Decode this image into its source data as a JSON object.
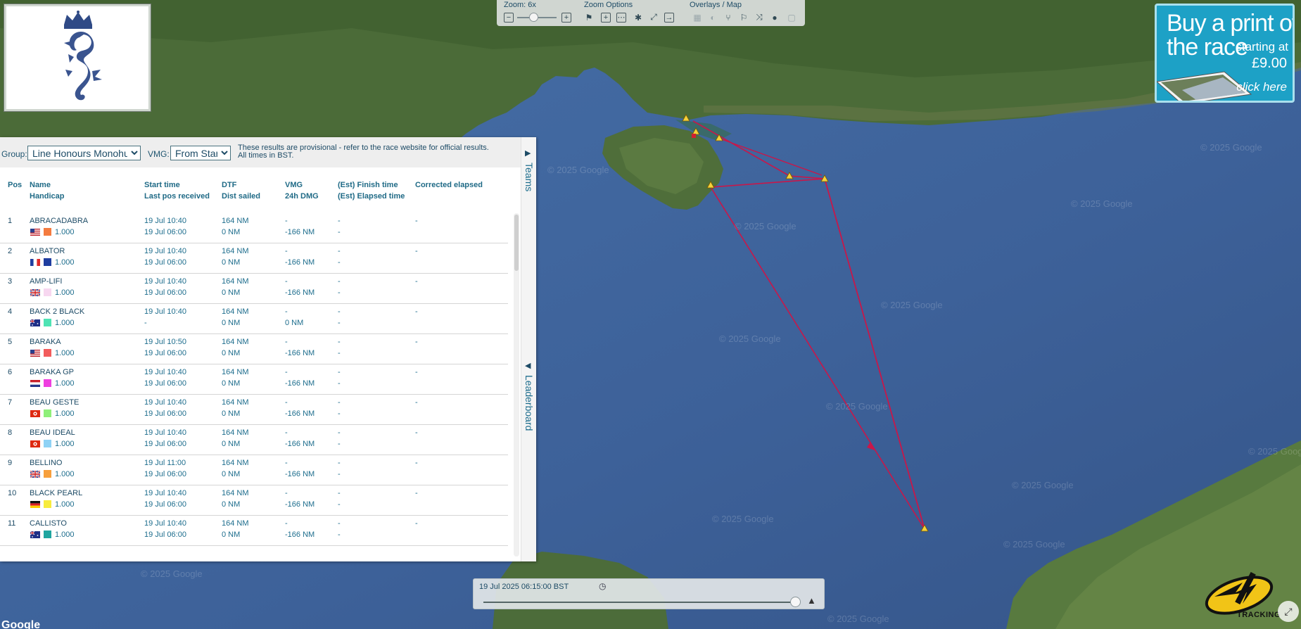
{
  "map": {
    "watermark": "© 2025 Google",
    "google_logo": "Google"
  },
  "toolbar": {
    "zoom_label": "Zoom: 6x",
    "zoom_options_label": "Zoom Options",
    "overlays_label": "Overlays / Map"
  },
  "print_ad": {
    "line1": "Buy a print of",
    "line2": "the race",
    "starting": "starting at",
    "price": "£9.00",
    "click": "click here"
  },
  "leaderboard": {
    "group_label": "Group:",
    "group_value": "Line Honours Monohull",
    "vmg_label": "VMG:",
    "vmg_value": "From Start",
    "note_line1": "These results are provisional - refer to the race website for official results.",
    "note_line2": "All times in BST.",
    "tab_teams": "Teams",
    "tab_leaderboard": "Leaderboard",
    "columns": {
      "pos": "Pos",
      "name": "Name",
      "handicap": "Handicap",
      "start": "Start time",
      "last_pos": "Last pos received",
      "dtf": "DTF",
      "dist": "Dist sailed",
      "vmg": "VMG",
      "dmg": "24h DMG",
      "finish": "(Est) Finish time",
      "elapsed": "(Est) Elapsed time",
      "corrected": "Corrected elapsed"
    },
    "rows": [
      {
        "pos": "1",
        "name": "ABRACADABRA",
        "flag": "us",
        "color": "#f47b3f",
        "handicap": "1.000",
        "start": "19 Jul 10:40",
        "last": "19 Jul 06:00",
        "dtf": "164 NM",
        "dist": "0 NM",
        "vmg": "-",
        "dmg": "-166 NM",
        "finish": "-",
        "elapsed": "-",
        "corrected": "-"
      },
      {
        "pos": "2",
        "name": "ALBATOR",
        "flag": "fr",
        "color": "#1f3ea0",
        "handicap": "1.000",
        "start": "19 Jul 10:40",
        "last": "19 Jul 06:00",
        "dtf": "164 NM",
        "dist": "0 NM",
        "vmg": "-",
        "dmg": "-166 NM",
        "finish": "-",
        "elapsed": "-",
        "corrected": "-"
      },
      {
        "pos": "3",
        "name": "AMP-LIFI",
        "flag": "gb",
        "color": "#f7d7f0",
        "handicap": "1.000",
        "start": "19 Jul 10:40",
        "last": "19 Jul 06:00",
        "dtf": "164 NM",
        "dist": "0 NM",
        "vmg": "-",
        "dmg": "-166 NM",
        "finish": "-",
        "elapsed": "-",
        "corrected": "-"
      },
      {
        "pos": "4",
        "name": "BACK 2 BLACK",
        "flag": "au",
        "color": "#4fe3b4",
        "handicap": "1.000",
        "start": "19 Jul 10:40",
        "last": "-",
        "dtf": "164 NM",
        "dist": "0 NM",
        "vmg": "-",
        "dmg": "0 NM",
        "finish": "-",
        "elapsed": "-",
        "corrected": "-"
      },
      {
        "pos": "5",
        "name": "BARAKA",
        "flag": "us",
        "color": "#f25c5c",
        "handicap": "1.000",
        "start": "19 Jul 10:50",
        "last": "19 Jul 06:00",
        "dtf": "164 NM",
        "dist": "0 NM",
        "vmg": "-",
        "dmg": "-166 NM",
        "finish": "-",
        "elapsed": "-",
        "corrected": "-"
      },
      {
        "pos": "6",
        "name": "BARAKA GP",
        "flag": "nl",
        "color": "#ef3fe0",
        "handicap": "1.000",
        "start": "19 Jul 10:40",
        "last": "19 Jul 06:00",
        "dtf": "164 NM",
        "dist": "0 NM",
        "vmg": "-",
        "dmg": "-166 NM",
        "finish": "-",
        "elapsed": "-",
        "corrected": "-"
      },
      {
        "pos": "7",
        "name": "BEAU GESTE",
        "flag": "hk",
        "color": "#8ff07a",
        "handicap": "1.000",
        "start": "19 Jul 10:40",
        "last": "19 Jul 06:00",
        "dtf": "164 NM",
        "dist": "0 NM",
        "vmg": "-",
        "dmg": "-166 NM",
        "finish": "-",
        "elapsed": "-",
        "corrected": "-"
      },
      {
        "pos": "8",
        "name": "BEAU IDEAL",
        "flag": "hk",
        "color": "#8fd2f5",
        "handicap": "1.000",
        "start": "19 Jul 10:40",
        "last": "19 Jul 06:00",
        "dtf": "164 NM",
        "dist": "0 NM",
        "vmg": "-",
        "dmg": "-166 NM",
        "finish": "-",
        "elapsed": "-",
        "corrected": "-"
      },
      {
        "pos": "9",
        "name": "BELLINO",
        "flag": "gb",
        "color": "#f7a03d",
        "handicap": "1.000",
        "start": "19 Jul 11:00",
        "last": "19 Jul 06:00",
        "dtf": "164 NM",
        "dist": "0 NM",
        "vmg": "-",
        "dmg": "-166 NM",
        "finish": "-",
        "elapsed": "-",
        "corrected": "-"
      },
      {
        "pos": "10",
        "name": "BLACK PEARL",
        "flag": "de",
        "color": "#f7ec3d",
        "handicap": "1.000",
        "start": "19 Jul 10:40",
        "last": "19 Jul 06:00",
        "dtf": "164 NM",
        "dist": "0 NM",
        "vmg": "-",
        "dmg": "-166 NM",
        "finish": "-",
        "elapsed": "-",
        "corrected": "-"
      },
      {
        "pos": "11",
        "name": "CALLISTO",
        "flag": "au",
        "color": "#1fa5a0",
        "handicap": "1.000",
        "start": "19 Jul 10:40",
        "last": "19 Jul 06:00",
        "dtf": "164 NM",
        "dist": "0 NM",
        "vmg": "-",
        "dmg": "-166 NM",
        "finish": "-",
        "elapsed": "-",
        "corrected": "-"
      }
    ]
  },
  "timebar": {
    "time": "19 Jul 2025 06:15:00 BST"
  },
  "tracking_logo": {
    "text": "TRACKING"
  },
  "colors": {
    "accent": "#1d6d8d",
    "route": "#c8174a",
    "sea": "#3b5e95"
  }
}
